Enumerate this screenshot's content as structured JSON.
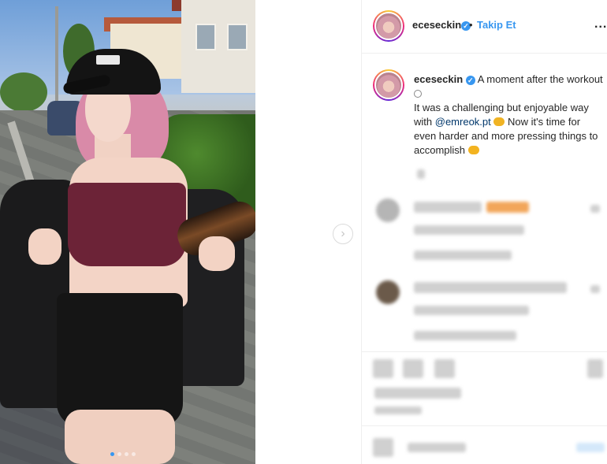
{
  "post": {
    "author": {
      "username": "eceseckin",
      "verified": true
    },
    "header": {
      "bullet": "•",
      "follow_label": "Takip Et",
      "more_label": "..."
    },
    "caption": {
      "username": "eceseckin",
      "text_line1": "A moment after the workout",
      "text_line2": "It was a challenging but enjoyable way with",
      "mention": "@emreok.pt",
      "text_line3": "Now it's time for even harder and more pressing things to accomplish"
    },
    "carousel": {
      "total_slides": 4,
      "active_index": 0,
      "next_arrow": "›"
    },
    "icons": {
      "verified": "check-badge",
      "next": "chevron-right",
      "more": "ellipsis"
    },
    "colors": {
      "accent": "#3897f0",
      "mention": "#00376b",
      "text": "#262626",
      "divider": "#efefef"
    }
  }
}
